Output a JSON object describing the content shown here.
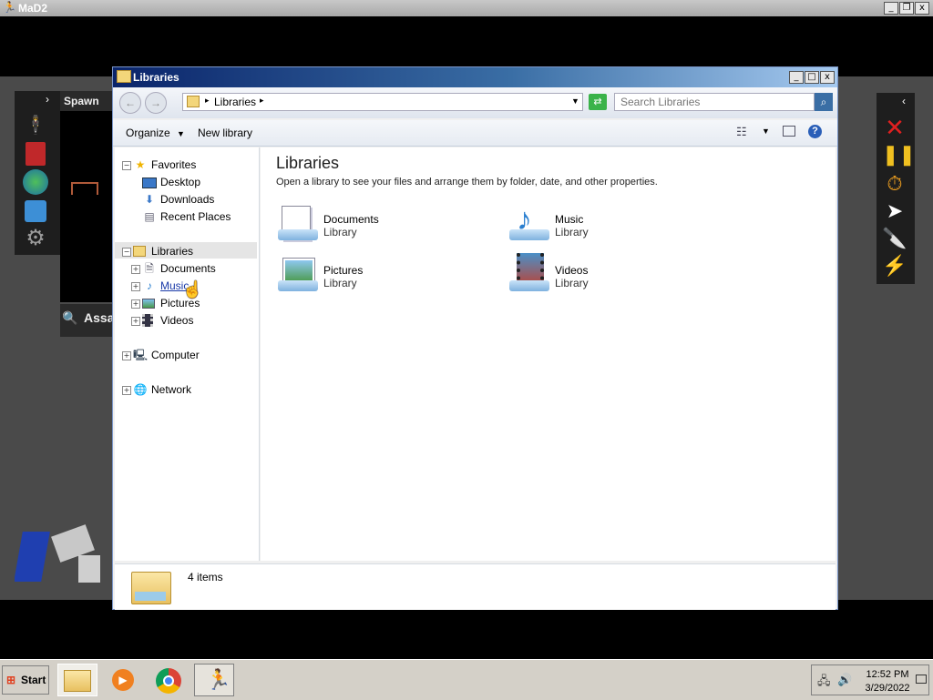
{
  "app": {
    "title": "MaD2"
  },
  "mad": {
    "spawn_label": "Spawn",
    "search_text": "Assa"
  },
  "window": {
    "title": "Libraries",
    "controls": {
      "minimize": "_",
      "maximize": "□",
      "close": "x"
    }
  },
  "address": {
    "breadcrumb": "Libraries"
  },
  "search": {
    "placeholder": "Search Libraries"
  },
  "toolbar": {
    "organize": "Organize",
    "new_library": "New library"
  },
  "nav": {
    "favorites": {
      "label": "Favorites",
      "items": [
        {
          "label": "Desktop",
          "icon": "desktop-icon"
        },
        {
          "label": "Downloads",
          "icon": "downloads-icon"
        },
        {
          "label": "Recent Places",
          "icon": "recent-places-icon"
        }
      ]
    },
    "libraries": {
      "label": "Libraries",
      "items": [
        {
          "label": "Documents"
        },
        {
          "label": "Music"
        },
        {
          "label": "Pictures"
        },
        {
          "label": "Videos"
        }
      ]
    },
    "computer": {
      "label": "Computer"
    },
    "network": {
      "label": "Network"
    }
  },
  "content": {
    "heading": "Libraries",
    "description": "Open a library to see your files and arrange them by folder, date, and other properties.",
    "libraries": [
      {
        "name": "Documents",
        "sub": "Library"
      },
      {
        "name": "Music",
        "sub": "Library"
      },
      {
        "name": "Pictures",
        "sub": "Library"
      },
      {
        "name": "Videos",
        "sub": "Library"
      }
    ]
  },
  "details": {
    "count": "4 items"
  },
  "taskbar": {
    "start_label": "Start",
    "clock": {
      "time": "12:52 PM",
      "date": "3/29/2022"
    }
  }
}
